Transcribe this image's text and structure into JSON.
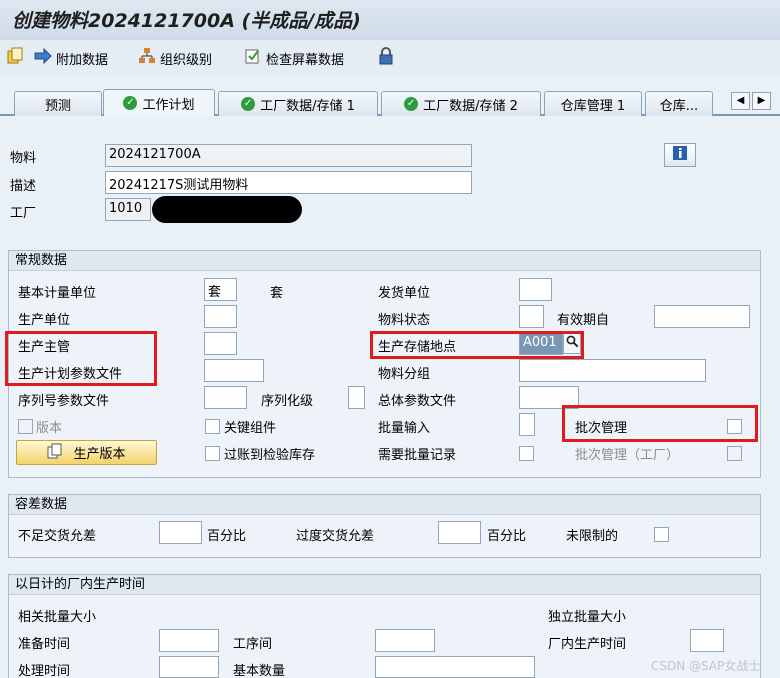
{
  "window": {
    "title": "创建物料2024121700A (半成品/成品)"
  },
  "toolbar": {
    "items": [
      {
        "label": "附加数据"
      },
      {
        "label": "组织级别"
      },
      {
        "label": "检查屏幕数据"
      }
    ]
  },
  "tabs": [
    {
      "label": "预测"
    },
    {
      "label": "工作计划"
    },
    {
      "label": "工厂数据/存储 1"
    },
    {
      "label": "工厂数据/存储 2"
    },
    {
      "label": "仓库管理 1"
    },
    {
      "label": "仓库..."
    }
  ],
  "header": {
    "material_label": "物料",
    "material_value": "2024121700A",
    "desc_label": "描述",
    "desc_value": "20241217S测试用物料",
    "plant_label": "工厂",
    "plant_value": "1010"
  },
  "general": {
    "title": "常规数据",
    "base_uom_label": "基本计量单位",
    "base_uom_value": "套",
    "base_uom_text": "套",
    "issue_unit_label": "发货单位",
    "issue_unit_value": "",
    "prod_unit_label": "生产单位",
    "prod_unit_value": "",
    "mat_status_label": "物料状态",
    "mat_status_value": "",
    "valid_from_label": "有效期自",
    "valid_from_value": "",
    "prod_supervisor_label": "生产主管",
    "prod_supervisor_value": "",
    "prod_storage_label": "生产存储地点",
    "prod_storage_value": "A001",
    "prod_sched_profile_label": "生产计划参数文件",
    "prod_sched_profile_value": "",
    "mat_group_label": "物料分组",
    "mat_group_value": "",
    "serial_profile_label": "序列号参数文件",
    "serial_profile_value": "",
    "serialization_label": "序列化级",
    "serialization_value": "",
    "overall_profile_label": "总体参数文件",
    "overall_profile_value": "",
    "version_label": "版本",
    "critical_part_label": "关键组件",
    "batch_entry_label": "批量输入",
    "batch_entry_value": "",
    "batch_mgmt_label": "批次管理",
    "prod_version_btn": "生产版本",
    "post_to_insp_label": "过账到检验库存",
    "batch_record_label": "需要批量记录",
    "batch_mgmt_plant_label": "批次管理（工厂）"
  },
  "tolerance": {
    "title": "容差数据",
    "under_label": "不足交货允差",
    "under_value": "",
    "under_unit": "百分比",
    "over_label": "过度交货允差",
    "over_value": "",
    "over_unit": "百分比",
    "unlimited_label": "未限制的"
  },
  "inhouse": {
    "title": "以日计的厂内生产时间",
    "lot_dep_label": "相关批量大小",
    "lot_indep_label": "独立批量大小",
    "setup_label": "准备时间",
    "setup_value": "",
    "interop_label": "工序间",
    "interop_value": "",
    "inhouse_label": "厂内生产时间",
    "inhouse_value": "",
    "processing_label": "处理时间",
    "processing_value": "",
    "base_qty_label": "基本数量",
    "base_qty_value": ""
  },
  "watermark": "CSDN @SAP女战士"
}
